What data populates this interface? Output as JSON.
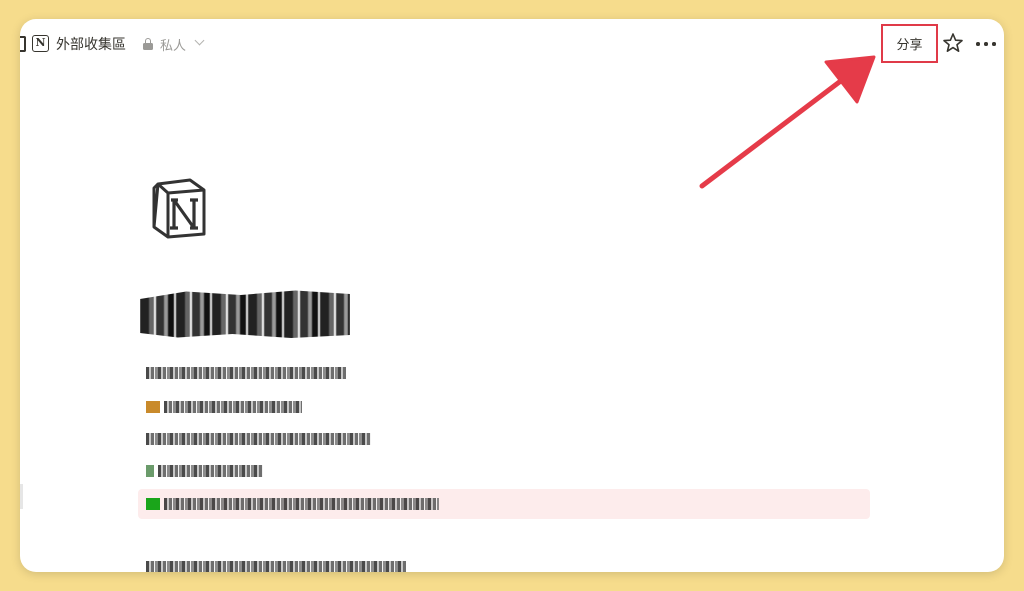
{
  "topbar": {
    "page_title": "外部收集區",
    "privacy": "私人",
    "share_label": "分享"
  },
  "page": {
    "icon": "notion-logo-icon"
  },
  "colors": {
    "background": "#f6dc8c",
    "annotation_red": "#e03a48",
    "highlight_row": "#fdecec",
    "text": "#37352f"
  }
}
